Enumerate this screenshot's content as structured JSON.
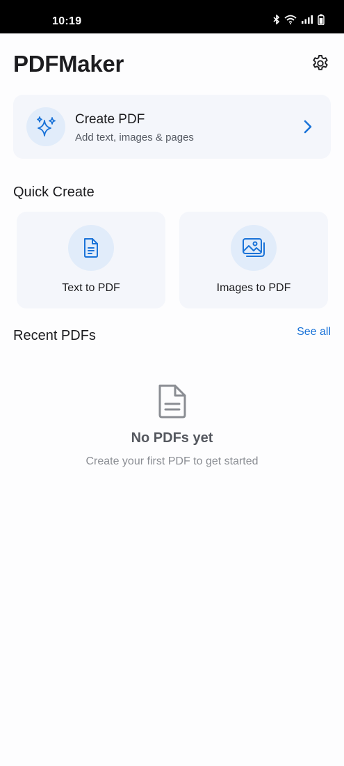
{
  "status_bar": {
    "time": "10:19",
    "icons": [
      "bluetooth-icon",
      "wifi-icon",
      "signal-icon",
      "battery-icon"
    ]
  },
  "header": {
    "title": "PDFMaker",
    "settings_icon": "gear-icon"
  },
  "create_card": {
    "title": "Create PDF",
    "subtitle": "Add text, images & pages",
    "icon": "sparkles-icon",
    "chevron_icon": "chevron-right-icon"
  },
  "quick_create": {
    "heading": "Quick Create",
    "items": [
      {
        "label": "Text to PDF",
        "icon": "document-text-icon"
      },
      {
        "label": "Images to PDF",
        "icon": "images-icon"
      }
    ]
  },
  "recent": {
    "heading": "Recent PDFs",
    "see_all": "See all",
    "empty_title": "No PDFs yet",
    "empty_subtitle": "Create your first PDF to get started",
    "empty_icon": "document-icon"
  },
  "colors": {
    "accent": "#1a73d8",
    "card_bg": "#f4f6fb",
    "icon_circle_bg": "#e1ecfa",
    "status_bar_bg": "#000000"
  }
}
